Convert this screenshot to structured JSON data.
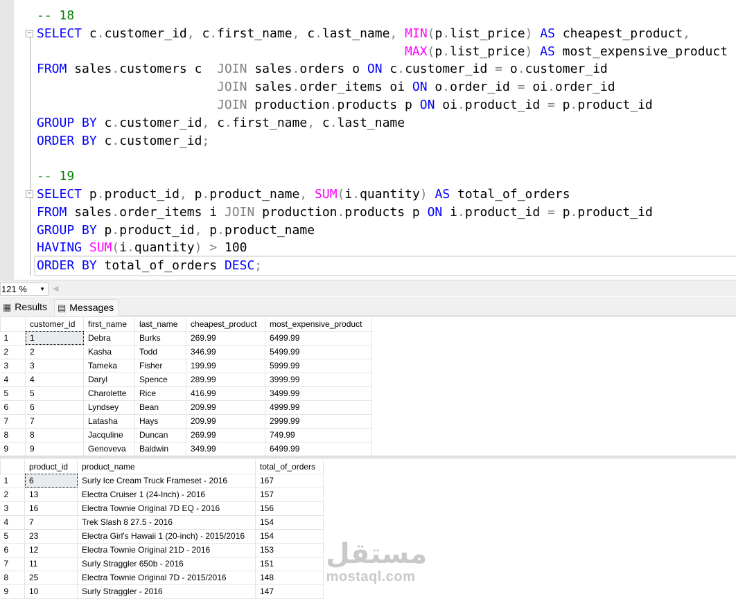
{
  "editor": {
    "lines": [
      [
        [
          "cm",
          "-- 18"
        ]
      ],
      [
        [
          "kw",
          "SELECT"
        ],
        [
          "tx",
          " c"
        ],
        [
          "op",
          "."
        ],
        [
          "tx",
          "customer_id"
        ],
        [
          "op",
          ","
        ],
        [
          "tx",
          " c"
        ],
        [
          "op",
          "."
        ],
        [
          "tx",
          "first_name"
        ],
        [
          "op",
          ","
        ],
        [
          "tx",
          " c"
        ],
        [
          "op",
          "."
        ],
        [
          "tx",
          "last_name"
        ],
        [
          "op",
          ","
        ],
        [
          "tx",
          " "
        ],
        [
          "fn",
          "MIN"
        ],
        [
          "op",
          "("
        ],
        [
          "tx",
          "p"
        ],
        [
          "op",
          "."
        ],
        [
          "tx",
          "list_price"
        ],
        [
          "op",
          ")"
        ],
        [
          "tx",
          " "
        ],
        [
          "kw",
          "AS"
        ],
        [
          "tx",
          " cheapest_product"
        ],
        [
          "op",
          ","
        ]
      ],
      [
        [
          "tx",
          "                                                 "
        ],
        [
          "fn",
          "MAX"
        ],
        [
          "op",
          "("
        ],
        [
          "tx",
          "p"
        ],
        [
          "op",
          "."
        ],
        [
          "tx",
          "list_price"
        ],
        [
          "op",
          ")"
        ],
        [
          "tx",
          " "
        ],
        [
          "kw",
          "AS"
        ],
        [
          "tx",
          " most_expensive_product"
        ]
      ],
      [
        [
          "kw",
          "FROM"
        ],
        [
          "tx",
          " sales"
        ],
        [
          "op",
          "."
        ],
        [
          "tx",
          "customers c  "
        ],
        [
          "op",
          "JOIN"
        ],
        [
          "tx",
          " sales"
        ],
        [
          "op",
          "."
        ],
        [
          "tx",
          "orders o "
        ],
        [
          "kw",
          "ON"
        ],
        [
          "tx",
          " c"
        ],
        [
          "op",
          "."
        ],
        [
          "tx",
          "customer_id "
        ],
        [
          "op",
          "="
        ],
        [
          "tx",
          " o"
        ],
        [
          "op",
          "."
        ],
        [
          "tx",
          "customer_id"
        ]
      ],
      [
        [
          "tx",
          "                        "
        ],
        [
          "op",
          "JOIN"
        ],
        [
          "tx",
          " sales"
        ],
        [
          "op",
          "."
        ],
        [
          "tx",
          "order_items oi "
        ],
        [
          "kw",
          "ON"
        ],
        [
          "tx",
          " o"
        ],
        [
          "op",
          "."
        ],
        [
          "tx",
          "order_id "
        ],
        [
          "op",
          "="
        ],
        [
          "tx",
          " oi"
        ],
        [
          "op",
          "."
        ],
        [
          "tx",
          "order_id"
        ]
      ],
      [
        [
          "tx",
          "                        "
        ],
        [
          "op",
          "JOIN"
        ],
        [
          "tx",
          " production"
        ],
        [
          "op",
          "."
        ],
        [
          "tx",
          "products p "
        ],
        [
          "kw",
          "ON"
        ],
        [
          "tx",
          " oi"
        ],
        [
          "op",
          "."
        ],
        [
          "tx",
          "product_id "
        ],
        [
          "op",
          "="
        ],
        [
          "tx",
          " p"
        ],
        [
          "op",
          "."
        ],
        [
          "tx",
          "product_id"
        ]
      ],
      [
        [
          "kw",
          "GROUP BY"
        ],
        [
          "tx",
          " c"
        ],
        [
          "op",
          "."
        ],
        [
          "tx",
          "customer_id"
        ],
        [
          "op",
          ","
        ],
        [
          "tx",
          " c"
        ],
        [
          "op",
          "."
        ],
        [
          "tx",
          "first_name"
        ],
        [
          "op",
          ","
        ],
        [
          "tx",
          " c"
        ],
        [
          "op",
          "."
        ],
        [
          "tx",
          "last_name"
        ]
      ],
      [
        [
          "kw",
          "ORDER BY"
        ],
        [
          "tx",
          " c"
        ],
        [
          "op",
          "."
        ],
        [
          "tx",
          "customer_id"
        ],
        [
          "op",
          ";"
        ]
      ],
      [],
      [
        [
          "cm",
          "-- 19"
        ]
      ],
      [
        [
          "kw",
          "SELECT"
        ],
        [
          "tx",
          " p"
        ],
        [
          "op",
          "."
        ],
        [
          "tx",
          "product_id"
        ],
        [
          "op",
          ","
        ],
        [
          "tx",
          " p"
        ],
        [
          "op",
          "."
        ],
        [
          "tx",
          "product_name"
        ],
        [
          "op",
          ","
        ],
        [
          "tx",
          " "
        ],
        [
          "fn",
          "SUM"
        ],
        [
          "op",
          "("
        ],
        [
          "tx",
          "i"
        ],
        [
          "op",
          "."
        ],
        [
          "tx",
          "quantity"
        ],
        [
          "op",
          ")"
        ],
        [
          "tx",
          " "
        ],
        [
          "kw",
          "AS"
        ],
        [
          "tx",
          " total_of_orders"
        ]
      ],
      [
        [
          "kw",
          "FROM"
        ],
        [
          "tx",
          " sales"
        ],
        [
          "op",
          "."
        ],
        [
          "tx",
          "order_items i "
        ],
        [
          "op",
          "JOIN"
        ],
        [
          "tx",
          " production"
        ],
        [
          "op",
          "."
        ],
        [
          "tx",
          "products p "
        ],
        [
          "kw",
          "ON"
        ],
        [
          "tx",
          " i"
        ],
        [
          "op",
          "."
        ],
        [
          "tx",
          "product_id "
        ],
        [
          "op",
          "="
        ],
        [
          "tx",
          " p"
        ],
        [
          "op",
          "."
        ],
        [
          "tx",
          "product_id"
        ]
      ],
      [
        [
          "kw",
          "GROUP BY"
        ],
        [
          "tx",
          " p"
        ],
        [
          "op",
          "."
        ],
        [
          "tx",
          "product_id"
        ],
        [
          "op",
          ","
        ],
        [
          "tx",
          " p"
        ],
        [
          "op",
          "."
        ],
        [
          "tx",
          "product_name"
        ]
      ],
      [
        [
          "kw",
          "HAVING"
        ],
        [
          "tx",
          " "
        ],
        [
          "fn",
          "SUM"
        ],
        [
          "op",
          "("
        ],
        [
          "tx",
          "i"
        ],
        [
          "op",
          "."
        ],
        [
          "tx",
          "quantity"
        ],
        [
          "op",
          ")"
        ],
        [
          "tx",
          " "
        ],
        [
          "op",
          ">"
        ],
        [
          "tx",
          " 100"
        ]
      ],
      [
        [
          "kw",
          "ORDER BY"
        ],
        [
          "tx",
          " total_of_orders "
        ],
        [
          "kw",
          "DESC"
        ],
        [
          "op",
          ";"
        ]
      ]
    ],
    "collapse_symbol": "−",
    "colors": {
      "keyword": "#0000ff",
      "function": "#ff00ff",
      "comment": "#008000",
      "operator": "#808080"
    }
  },
  "zoom": {
    "value": "121 %"
  },
  "tabs": {
    "results": "Results",
    "messages": "Messages"
  },
  "grid1": {
    "columns": [
      "customer_id",
      "first_name",
      "last_name",
      "cheapest_product",
      "most_expensive_product"
    ],
    "rows": [
      [
        "1",
        "1",
        "Debra",
        "Burks",
        "269.99",
        "6499.99"
      ],
      [
        "2",
        "2",
        "Kasha",
        "Todd",
        "346.99",
        "5499.99"
      ],
      [
        "3",
        "3",
        "Tameka",
        "Fisher",
        "199.99",
        "5999.99"
      ],
      [
        "4",
        "4",
        "Daryl",
        "Spence",
        "289.99",
        "3999.99"
      ],
      [
        "5",
        "5",
        "Charolette",
        "Rice",
        "416.99",
        "3499.99"
      ],
      [
        "6",
        "6",
        "Lyndsey",
        "Bean",
        "209.99",
        "4999.99"
      ],
      [
        "7",
        "7",
        "Latasha",
        "Hays",
        "209.99",
        "2999.99"
      ],
      [
        "8",
        "8",
        "Jacquline",
        "Duncan",
        "269.99",
        "749.99"
      ],
      [
        "9",
        "9",
        "Genoveva",
        "Baldwin",
        "349.99",
        "6499.99"
      ]
    ]
  },
  "grid2": {
    "columns": [
      "product_id",
      "product_name",
      "total_of_orders"
    ],
    "rows": [
      [
        "1",
        "6",
        "Surly Ice Cream Truck Frameset - 2016",
        "167"
      ],
      [
        "2",
        "13",
        "Electra Cruiser 1 (24-Inch) - 2016",
        "157"
      ],
      [
        "3",
        "16",
        "Electra Townie Original 7D EQ - 2016",
        "156"
      ],
      [
        "4",
        "7",
        "Trek Slash 8 27.5 - 2016",
        "154"
      ],
      [
        "5",
        "23",
        "Electra Girl's Hawaii 1 (20-inch) - 2015/2016",
        "154"
      ],
      [
        "6",
        "12",
        "Electra Townie Original 21D - 2016",
        "153"
      ],
      [
        "7",
        "11",
        "Surly Straggler 650b - 2016",
        "151"
      ],
      [
        "8",
        "25",
        "Electra Townie Original 7D - 2015/2016",
        "148"
      ],
      [
        "9",
        "10",
        "Surly Straggler - 2016",
        "147"
      ]
    ]
  },
  "watermark": {
    "arabic": "مستقل",
    "latin": "mostaql.com"
  }
}
